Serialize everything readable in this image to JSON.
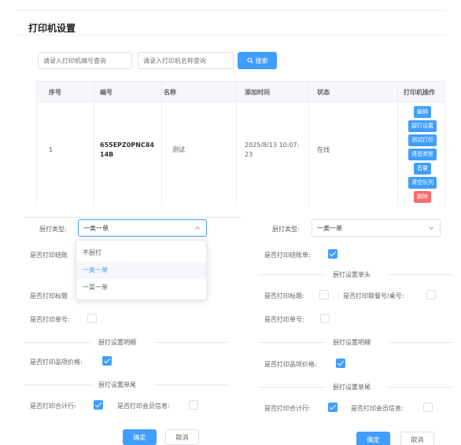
{
  "page": {
    "title": "打印机设置"
  },
  "search": {
    "code_placeholder": "请录入打印机编号查询",
    "name_placeholder": "请录入打印机名称查询",
    "button_label": "搜索"
  },
  "table": {
    "headers": [
      "序号",
      "编号",
      "名称",
      "添加时间",
      "状态",
      "打印机操作"
    ],
    "rows": [
      {
        "index": "1",
        "code_line1": "655EPZ0PNC84",
        "code_line2": "14B",
        "name": "测试",
        "time_line1": "2025/8/13 10:07:",
        "time_line2": "23",
        "status": "在线",
        "ops": [
          "编辑",
          "厨打设置",
          "测试打印",
          "语音类型",
          "音量",
          "清空队列",
          "删除"
        ]
      }
    ]
  },
  "left_form": {
    "kitchen_type_label": "厨打类型:",
    "kitchen_type_value": "一类一单",
    "print_checkout_label": "是否打印结账",
    "print_title_label": "是否打印标题",
    "print_order_no_label": "是否打印单号:",
    "detail_section": "厨打设置明细",
    "print_item_price_label": "是否打印品项价格:",
    "footer_section": "厨打设置单尾",
    "print_total_label": "是否打印合计行:",
    "print_member_label": "是否打印会员信息:",
    "confirm": "确定",
    "cancel": "取消",
    "dropdown_options": [
      "不厨打",
      "一类一单",
      "一菜一单"
    ],
    "dropdown_selected": "一类一单"
  },
  "right_form": {
    "kitchen_type_label": "厨打类型:",
    "kitchen_type_value": "一类一单",
    "print_checkout_label": "是否打印结账单:",
    "header_section": "厨打设置单头",
    "print_title_label": "是否打印标题:",
    "print_pickup_label": "是否打印取餐号/桌号:",
    "print_order_no_label": "是否打印单号:",
    "detail_section": "厨打设置明细",
    "print_item_price_label": "是否打印品项价格:",
    "footer_section": "厨打设置单尾",
    "print_total_label": "是否打印合计行:",
    "print_member_label": "是否打印会员信息:",
    "confirm": "确定",
    "cancel": "取消"
  },
  "checkbox_states": {
    "checkout": true,
    "title": false,
    "pickup": false,
    "order_no": false,
    "item_price": true,
    "total": true,
    "member": false
  },
  "icons": [
    "search-icon",
    "chevron-up-icon",
    "chevron-down-icon",
    "checkmark-icon"
  ],
  "colors": {
    "primary": "#409eff",
    "danger": "#f56c6c",
    "border": "#dcdfe6"
  }
}
